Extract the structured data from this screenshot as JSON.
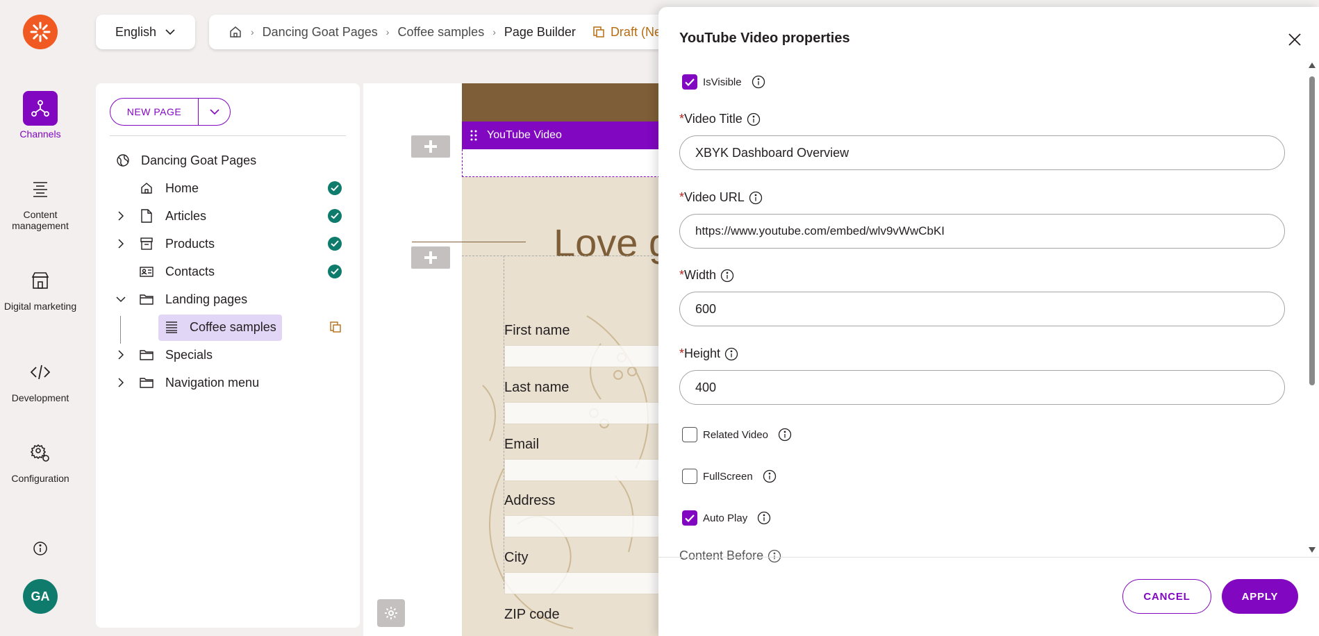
{
  "rail": {
    "items": [
      {
        "label": "Channels",
        "icon": "channels-icon",
        "active": true
      },
      {
        "label": "Content management",
        "icon": "content-management-icon",
        "active": false
      },
      {
        "label": "Digital marketing",
        "icon": "digital-marketing-icon",
        "active": false
      },
      {
        "label": "Development",
        "icon": "code-icon",
        "active": false
      },
      {
        "label": "Configuration",
        "icon": "gear-icon",
        "active": false
      }
    ],
    "avatar_initials": "GA"
  },
  "topbar": {
    "language": "English",
    "breadcrumbs": [
      "Dancing Goat Pages",
      "Coffee samples",
      "Page Builder"
    ],
    "status": "Draft (Ne"
  },
  "tree": {
    "new_page_label": "NEW PAGE",
    "root_label": "Dancing Goat Pages",
    "nodes": [
      {
        "label": "Home",
        "published": true
      },
      {
        "label": "Articles",
        "published": true
      },
      {
        "label": "Products",
        "published": true
      },
      {
        "label": "Contacts",
        "published": true
      },
      {
        "label": "Landing pages"
      },
      {
        "label": "Coffee samples",
        "selected": true,
        "draft": true
      },
      {
        "label": "Specials"
      },
      {
        "label": "Navigation menu"
      }
    ]
  },
  "canvas": {
    "widget_label": "YouTube Video",
    "hero_text": "Love g",
    "form_fields": [
      "First name",
      "Last name",
      "Email",
      "Address",
      "City",
      "ZIP code"
    ]
  },
  "dialog": {
    "title": "YouTube Video properties",
    "is_visible_label": "IsVisible",
    "is_visible": true,
    "video_title_label": "Video Title",
    "video_title_value": "XBYK Dashboard Overview",
    "video_url_label": "Video URL",
    "video_url_value": "https://www.youtube.com/embed/wlv9vWwCbKI",
    "width_label": "Width",
    "width_value": "600",
    "height_label": "Height",
    "height_value": "400",
    "related_video_label": "Related Video",
    "related_video": false,
    "fullscreen_label": "FullScreen",
    "fullscreen": false,
    "autoplay_label": "Auto Play",
    "autoplay": true,
    "content_before_label": "Content Before",
    "required_marker": "*",
    "cancel_label": "CANCEL",
    "apply_label": "APPLY"
  },
  "colors": {
    "accent": "#8107c1",
    "brand_orange": "#f05a22",
    "success": "#0f7b6c",
    "draft": "#b86c11"
  }
}
